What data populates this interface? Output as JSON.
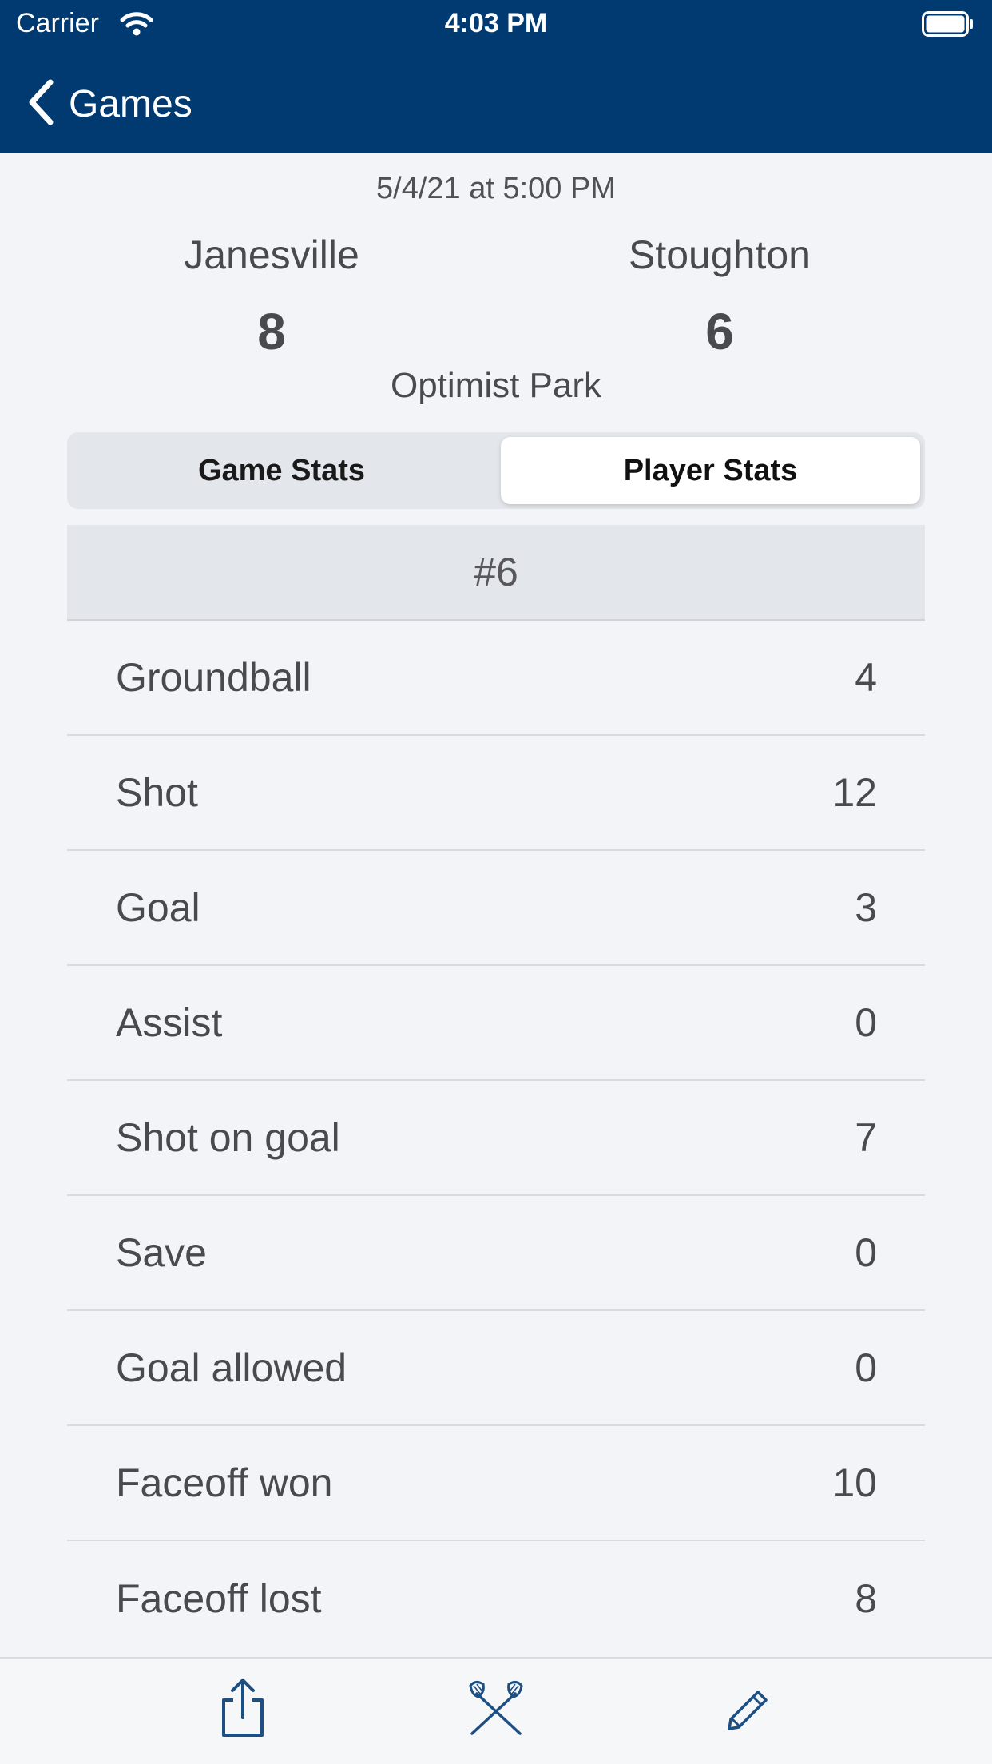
{
  "status_bar": {
    "carrier": "Carrier",
    "time": "4:03 PM"
  },
  "nav": {
    "back_label": "Games"
  },
  "game": {
    "datetime": "5/4/21 at 5:00 PM",
    "home_team": "Janesville",
    "home_score": "8",
    "away_team": "Stoughton",
    "away_score": "6",
    "venue": "Optimist Park"
  },
  "tabs": {
    "game_stats": "Game Stats",
    "player_stats": "Player Stats",
    "selected": "Player Stats"
  },
  "player": {
    "header": "#6",
    "stats": [
      {
        "label": "Groundball",
        "value": "4"
      },
      {
        "label": "Shot",
        "value": "12"
      },
      {
        "label": "Goal",
        "value": "3"
      },
      {
        "label": "Assist",
        "value": "0"
      },
      {
        "label": "Shot on goal",
        "value": "7"
      },
      {
        "label": "Save",
        "value": "0"
      },
      {
        "label": "Goal allowed",
        "value": "0"
      },
      {
        "label": "Faceoff won",
        "value": "10"
      },
      {
        "label": "Faceoff lost",
        "value": "8"
      }
    ]
  },
  "toolbar": {
    "icons": [
      "share-icon",
      "lacrosse-sticks-icon",
      "pencil-icon"
    ]
  },
  "colors": {
    "nav_background": "#003a70",
    "page_background": "#f2f4f7",
    "icon_color": "#1d4f82"
  }
}
